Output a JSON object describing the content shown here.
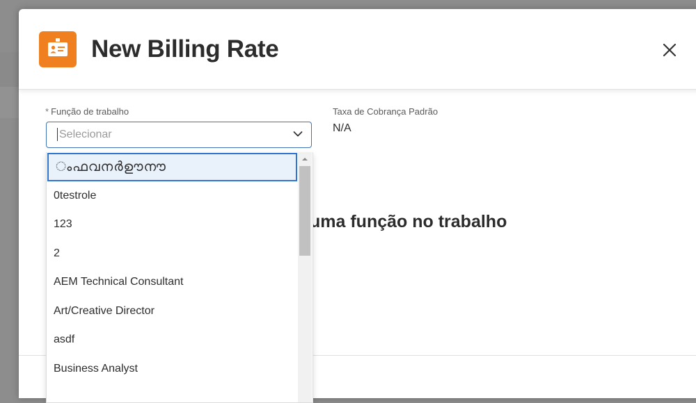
{
  "modal": {
    "title": "New Billing Rate"
  },
  "form": {
    "job_role_label": "Função de trabalho",
    "required_marker": "*",
    "job_role_placeholder": "Selecionar",
    "default_rate_label": "Taxa de Cobrança Padrão",
    "default_rate_value": "N/A"
  },
  "background_heading": "uma função no trabalho",
  "dropdown": {
    "options": [
      "ംഫവനർ​ഊ​നൗ",
      "0testrole",
      "123",
      "2",
      "AEM Technical Consultant",
      "Art/Creative Director",
      "asdf",
      "Business Analyst"
    ]
  },
  "colors": {
    "accent_orange": "#f07f1f",
    "focus_blue": "#2f75cf"
  }
}
